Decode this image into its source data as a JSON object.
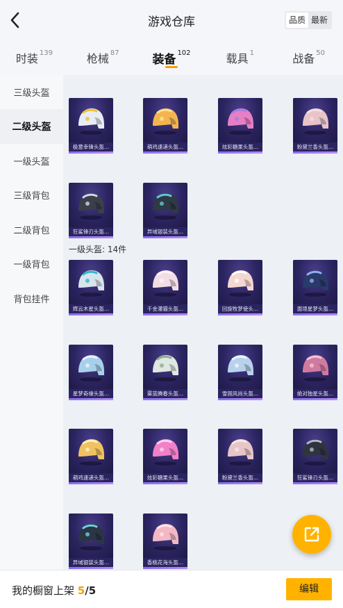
{
  "header": {
    "title": "游戏仓库",
    "sort_options": [
      "品质",
      "最新"
    ],
    "sort_selected": "品质"
  },
  "tabs": [
    {
      "label": "时装",
      "count": "139"
    },
    {
      "label": "枪械",
      "count": "87"
    },
    {
      "label": "装备",
      "count": "102"
    },
    {
      "label": "载具",
      "count": "1"
    },
    {
      "label": "战备",
      "count": "50"
    }
  ],
  "active_tab": "装备",
  "sidebar": {
    "items": [
      "三级头盔",
      "二级头盔",
      "一级头盔",
      "三级背包",
      "二级背包",
      "一级背包",
      "背包挂件"
    ],
    "active": "二级头盔"
  },
  "sections": [
    {
      "label": "",
      "items": [
        {
          "name": "极意幸锋头盔...",
          "color": "#e8ecf5",
          "accent": "#f0c030"
        },
        {
          "name": "萌鸡速递头盔...",
          "color": "#f3b550",
          "accent": "#ffe08a"
        },
        {
          "name": "炫彩糖果头盔...",
          "color": "#e77fc5",
          "accent": "#a080e0"
        },
        {
          "name": "粉黛兰香头盔...",
          "color": "#e8c4c8",
          "accent": "#f5dde0"
        },
        {
          "name": "狂鲨锋刃头盔...",
          "color": "#3a3f4a",
          "accent": "#d0d8e0"
        },
        {
          "name": "异域银装头盔...",
          "color": "#2e3a44",
          "accent": "#5fc8d8"
        }
      ]
    },
    {
      "label": "一级头盔: 14件",
      "items": [
        {
          "name": "辉云木星头盔...",
          "color": "#d8e4ec",
          "accent": "#30b8c8"
        },
        {
          "name": "千金灌猫头盔...",
          "color": "#f3dde4",
          "accent": "#fff2f6"
        },
        {
          "name": "回旋牧梦使头...",
          "color": "#f5d7d2",
          "accent": "#ffffff"
        },
        {
          "name": "面境星梦头盔...",
          "color": "#2a3a6a",
          "accent": "#8fb0f0"
        },
        {
          "name": "星梦奇缘头盔...",
          "color": "#a8d0ea",
          "accent": "#e8f4fc"
        },
        {
          "name": "雾蓝腾春头盔...",
          "color": "#dfe8e0",
          "accent": "#8faa90"
        },
        {
          "name": "雪国风尚头盔...",
          "color": "#b8d2ec",
          "accent": "#eef6ff"
        },
        {
          "name": "绝对独星头盔...",
          "color": "#d07aa0",
          "accent": "#f3c5d8"
        },
        {
          "name": "萌鸡速递头盔...",
          "color": "#f0c260",
          "accent": "#fff0c0"
        },
        {
          "name": "炫彩糖果头盔...",
          "color": "#f080c8",
          "accent": "#ffd0ef"
        },
        {
          "name": "粉黛兰香头盔...",
          "color": "#e8c6c8",
          "accent": "#f8e4e6"
        },
        {
          "name": "狂鲨锋刃头盔...",
          "color": "#2f3440",
          "accent": "#b0b8c8"
        },
        {
          "name": "异域银装头盔...",
          "color": "#2a3644",
          "accent": "#6fd0e0"
        },
        {
          "name": "香桃花海头盔...",
          "color": "#f2b8c4",
          "accent": "#ffe4ea"
        }
      ]
    }
  ],
  "shelf": {
    "label": "我的橱窗上架",
    "current": "5",
    "total": "/5"
  },
  "edit_label": "编辑",
  "colors": {
    "accent": "#ffb300",
    "card_bg": "#2b2460",
    "card_bar": "#9b7cf2"
  },
  "icons": [
    "back-arrow-icon",
    "share-external-icon"
  ]
}
